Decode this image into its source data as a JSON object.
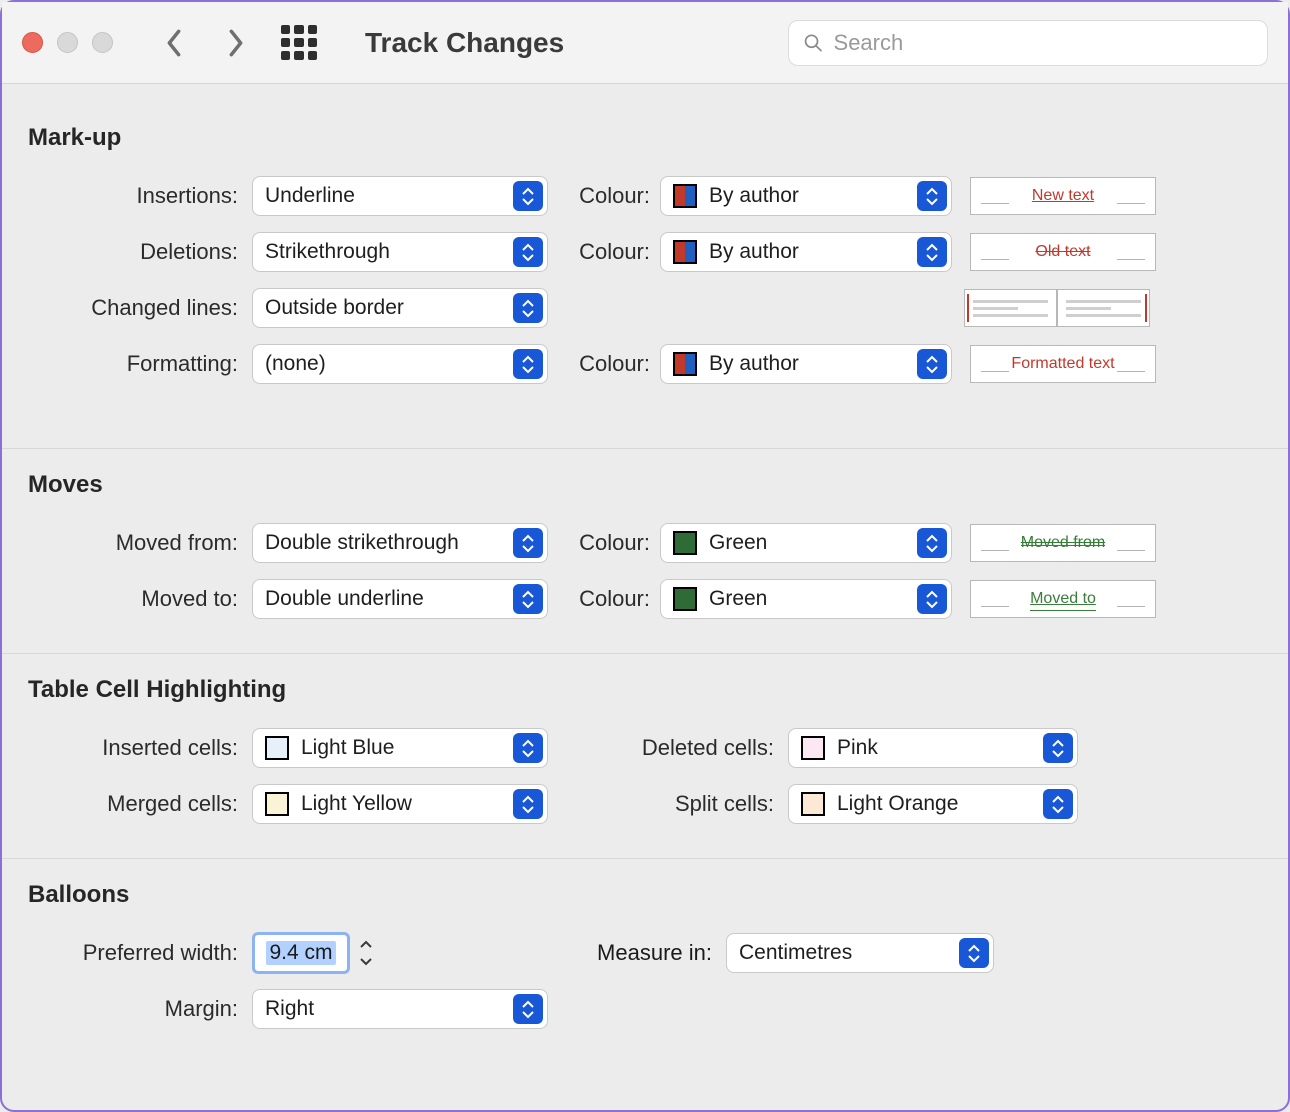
{
  "toolbar": {
    "title": "Track Changes",
    "search_placeholder": "Search"
  },
  "sections": {
    "markup": {
      "title": "Mark-up",
      "insertions_label": "Insertions:",
      "insertions_value": "Underline",
      "insertions_colour_label": "Colour:",
      "insertions_colour_value": "By author",
      "insertions_preview": "New text",
      "deletions_label": "Deletions:",
      "deletions_value": "Strikethrough",
      "deletions_colour_label": "Colour:",
      "deletions_colour_value": "By author",
      "deletions_preview": "Old text",
      "changed_lines_label": "Changed lines:",
      "changed_lines_value": "Outside border",
      "formatting_label": "Formatting:",
      "formatting_value": "(none)",
      "formatting_colour_label": "Colour:",
      "formatting_colour_value": "By author",
      "formatting_preview": "Formatted text"
    },
    "moves": {
      "title": "Moves",
      "moved_from_label": "Moved from:",
      "moved_from_value": "Double strikethrough",
      "moved_from_colour_label": "Colour:",
      "moved_from_colour_value": "Green",
      "moved_from_colour_hex": "#2f6b37",
      "moved_from_preview": "Moved from",
      "moved_to_label": "Moved to:",
      "moved_to_value": "Double underline",
      "moved_to_colour_label": "Colour:",
      "moved_to_colour_value": "Green",
      "moved_to_colour_hex": "#2f6b37",
      "moved_to_preview": "Moved to"
    },
    "table": {
      "title": "Table Cell Highlighting",
      "inserted_label": "Inserted cells:",
      "inserted_value": "Light Blue",
      "inserted_hex": "#e5f0fb",
      "deleted_label": "Deleted cells:",
      "deleted_value": "Pink",
      "deleted_hex": "#fce8f3",
      "merged_label": "Merged cells:",
      "merged_value": "Light Yellow",
      "merged_hex": "#fbf3d6",
      "split_label": "Split cells:",
      "split_value": "Light Orange",
      "split_hex": "#fbe9d6"
    },
    "balloons": {
      "title": "Balloons",
      "pref_width_label": "Preferred width:",
      "pref_width_value": "9.4 cm",
      "measure_label": "Measure in:",
      "measure_value": "Centimetres",
      "margin_label": "Margin:",
      "margin_value": "Right"
    }
  }
}
